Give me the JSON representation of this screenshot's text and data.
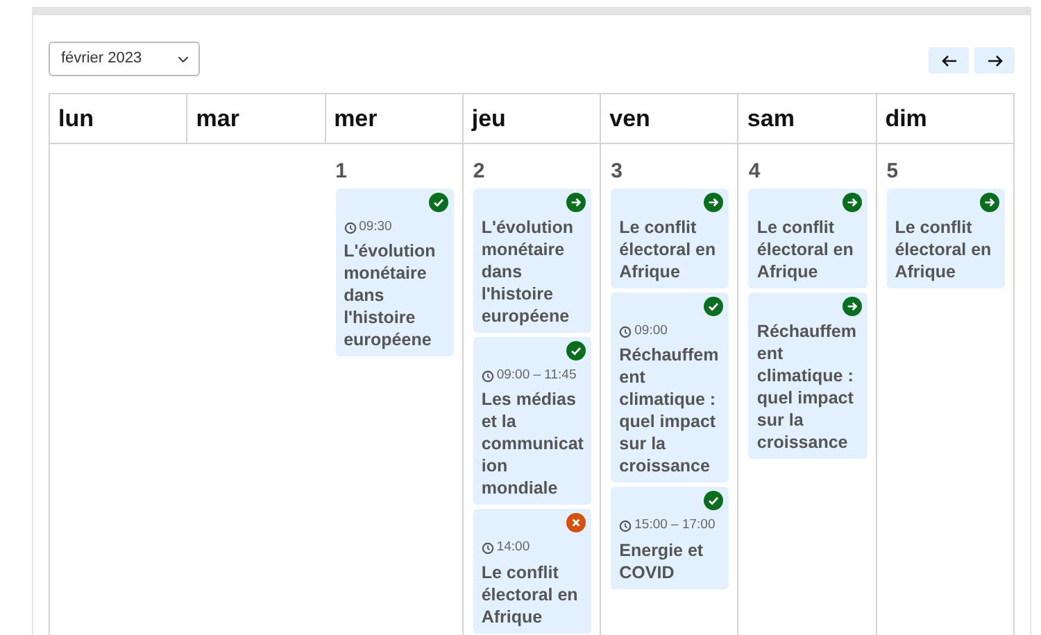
{
  "month_select": {
    "value": "février 2023"
  },
  "nav_buttons": [
    {
      "kind": "prev"
    },
    {
      "kind": "next"
    }
  ],
  "weekdays": [
    "lun",
    "mar",
    "mer",
    "jeu",
    "ven",
    "sam",
    "dim"
  ],
  "days": [
    {
      "number": "1",
      "events": [
        {
          "kind": "done",
          "time": "09:30",
          "title": "L'évolution monétaire dans l'histoire européene"
        }
      ]
    },
    {
      "number": "2",
      "events": [
        {
          "kind": "upcoming",
          "title": "L'évolution monétaire dans l'histoire européene"
        },
        {
          "kind": "done",
          "time": "09:00 – 11:45",
          "title": "Les médias et la communication mondiale"
        },
        {
          "kind": "cancelled",
          "time": "14:00",
          "title": "Le conflit électoral en Afrique"
        }
      ]
    },
    {
      "number": "3",
      "events": [
        {
          "kind": "upcoming",
          "title": "Le conflit électoral en Afrique"
        },
        {
          "kind": "done",
          "time": "09:00",
          "title": "Réchauffement climatique : quel impact sur la croissance"
        },
        {
          "kind": "done",
          "time": "15:00 – 17:00",
          "title": "Energie et COVID"
        }
      ]
    },
    {
      "number": "4",
      "events": [
        {
          "kind": "upcoming",
          "title": "Le conflit électoral en Afrique"
        },
        {
          "kind": "upcoming",
          "title": "Réchauffement climatique : quel impact sur la croissance"
        }
      ]
    },
    {
      "number": "5",
      "events": [
        {
          "kind": "upcoming",
          "title": "Le conflit électoral en Afrique"
        }
      ]
    }
  ]
}
